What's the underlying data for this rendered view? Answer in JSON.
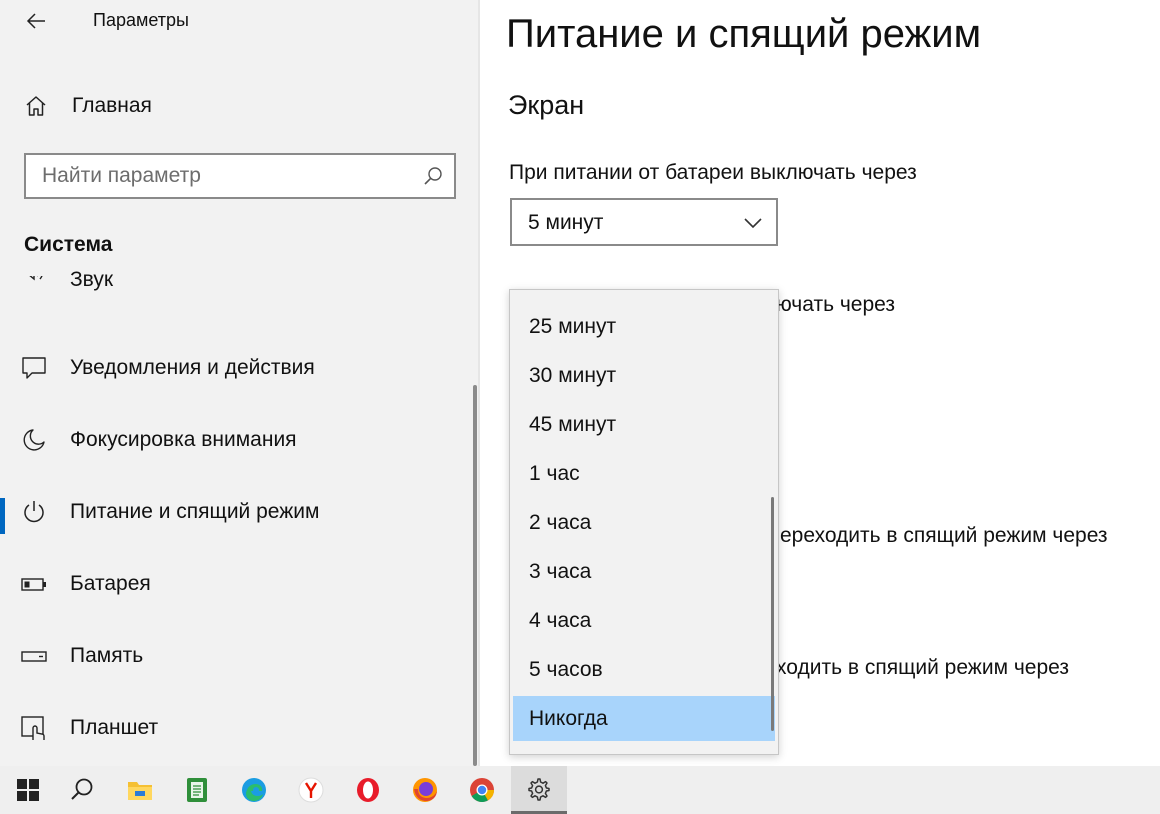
{
  "window": {
    "app_title": "Параметры",
    "back_icon": "back-arrow-icon"
  },
  "sidebar": {
    "home_label": "Главная",
    "home_icon": "home-icon",
    "search_placeholder": "Найти параметр",
    "search_icon": "search-icon",
    "section_title": "Система",
    "items": [
      {
        "label": "Звук",
        "icon": "speaker-icon",
        "active": false
      },
      {
        "label": "Уведомления и действия",
        "icon": "notification-icon",
        "active": false
      },
      {
        "label": "Фокусировка внимания",
        "icon": "moon-icon",
        "active": false
      },
      {
        "label": "Питание и спящий режим",
        "icon": "power-icon",
        "active": true
      },
      {
        "label": "Батарея",
        "icon": "battery-icon",
        "active": false
      },
      {
        "label": "Память",
        "icon": "storage-icon",
        "active": false
      },
      {
        "label": "Планшет",
        "icon": "tablet-icon",
        "active": false
      }
    ],
    "accent_color": "#0067c0"
  },
  "main": {
    "page_title": "Питание и спящий режим",
    "screen_section": "Экран",
    "battery_screen_label": "При питании от батареи выключать через",
    "battery_screen_value": "5 минут",
    "plugged_screen_label_partial": "ючать через",
    "battery_sleep_label_partial": "ереходить в спящий режим через",
    "plugged_sleep_label_partial": "ходить в спящий режим через"
  },
  "dropdown": {
    "options": [
      "25 минут",
      "30 минут",
      "45 минут",
      "1 час",
      "2 часа",
      "3 часа",
      "4 часа",
      "5 часов",
      "Никогда"
    ],
    "selected": "Никогда",
    "highlight_color": "#a8d4fb"
  },
  "taskbar": {
    "items": [
      {
        "name": "windows-start-icon",
        "active": false
      },
      {
        "name": "search-icon",
        "active": false
      },
      {
        "name": "file-explorer-icon",
        "active": false
      },
      {
        "name": "notepad-icon",
        "active": false
      },
      {
        "name": "edge-browser-icon",
        "active": false
      },
      {
        "name": "yandex-browser-icon",
        "active": false
      },
      {
        "name": "opera-browser-icon",
        "active": false
      },
      {
        "name": "firefox-browser-icon",
        "active": false
      },
      {
        "name": "chrome-browser-icon",
        "active": false
      },
      {
        "name": "settings-gear-icon",
        "active": true
      }
    ]
  }
}
